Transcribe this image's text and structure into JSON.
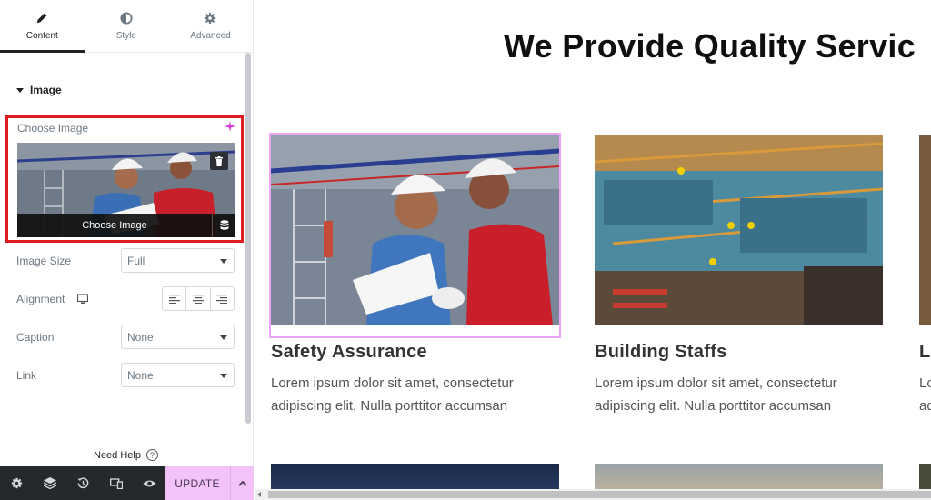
{
  "panel": {
    "tabs": [
      {
        "label": "Content",
        "icon": "pencil-icon",
        "active": true
      },
      {
        "label": "Style",
        "icon": "half-circle-icon",
        "active": false
      },
      {
        "label": "Advanced",
        "icon": "gear-icon",
        "active": false
      }
    ],
    "section_title": "Image",
    "choose_image_label": "Choose Image",
    "choose_image_button": "Choose Image",
    "controls": {
      "image_size_label": "Image Size",
      "image_size_value": "Full",
      "alignment_label": "Alignment",
      "caption_label": "Caption",
      "caption_value": "None",
      "link_label": "Link",
      "link_value": "None"
    },
    "need_help": "Need Help",
    "update_label": "UPDATE",
    "highlight_color": "#e11b22",
    "accent_color": "#f2c2f9"
  },
  "preview": {
    "title": "We Provide Quality Servic",
    "cards": [
      {
        "title": "Safety Assurance",
        "text_line1": "Lorem ipsum dolor sit amet, consectetur",
        "text_line2": "adipiscing elit. Nulla porttitor accumsan"
      },
      {
        "title": "Building Staffs",
        "text_line1": "Lorem ipsum dolor sit amet, consectetur",
        "text_line2": "adipiscing elit. Nulla porttitor accumsan"
      },
      {
        "title": "L",
        "text_line1": "Lo",
        "text_line2": "ad"
      }
    ]
  }
}
